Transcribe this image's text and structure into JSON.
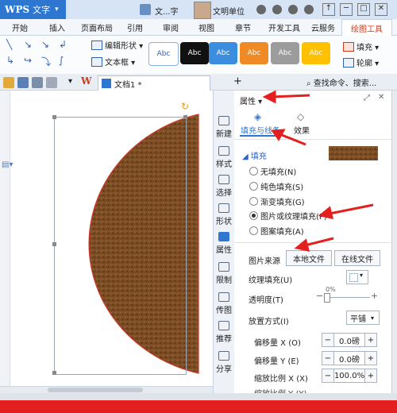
{
  "titlebar": {
    "app_logo": "WPS",
    "app_name": "文字",
    "app_dropdown": "▾",
    "doc_title": "文...字",
    "user_name": "文明单位",
    "win_min": "─",
    "win_max": "□",
    "win_close": "✕"
  },
  "menu": {
    "tabs": [
      "开始",
      "插入",
      "页面布局",
      "引用",
      "审阅",
      "视图",
      "章节",
      "开发工具",
      "云服务"
    ],
    "active_tab": "绘图工具"
  },
  "ribbon": {
    "edit_shape": "编辑形状 ▾",
    "text_box": "文本框 ▾",
    "swatch_label": "Abc",
    "swatches": [
      "#ffffff",
      "#111111",
      "#3b8de0",
      "#f08a24",
      "#9c9c9c",
      "#ffc000"
    ],
    "fill": "填充 ▾",
    "outline": "轮廓 ▾"
  },
  "quickbar": {
    "doc_tab": "文档1 *",
    "add_tab": "+",
    "search": "查找命令、搜索..."
  },
  "sidebar": {
    "items": [
      "新建",
      "样式",
      "选择",
      "形状",
      "属性",
      "限制",
      "传图",
      "推荐",
      "分享"
    ]
  },
  "panel": {
    "title": "属性 ▾",
    "tab_fill_line": "填充与线条",
    "tab_effects": "效果",
    "section_fill": "◢ 填充",
    "options": [
      {
        "label": "无填充(N)",
        "selected": false
      },
      {
        "label": "纯色填充(S)",
        "selected": false
      },
      {
        "label": "渐变填充(G)",
        "selected": false
      },
      {
        "label": "图片或纹理填充(P)",
        "selected": true
      },
      {
        "label": "图案填充(A)",
        "selected": false
      }
    ],
    "source_label": "图片来源",
    "local_file_btn": "本地文件",
    "online_file_btn": "在线文件",
    "texture_label": "纹理填充(U)",
    "transparency_label": "透明度(T)",
    "transparency_value": "0%",
    "placement_label": "放置方式(I)",
    "placement_value": "平铺",
    "offset_x_label": "偏移量 X (O)",
    "offset_x_value": "0.0磅",
    "offset_y_label": "偏移量 Y (E)",
    "offset_y_value": "0.0磅",
    "scale_x_label": "缩放比例 X (X)",
    "scale_x_value": "100.0%",
    "scale_y_label": "缩放比例 Y (Y)",
    "minus": "−",
    "plus": "+"
  },
  "colors": {
    "texture": "#7a4a22",
    "shape_outline": "#d23a2a",
    "accent": "#2d77d0",
    "annotation_red": "#e41f1f"
  }
}
